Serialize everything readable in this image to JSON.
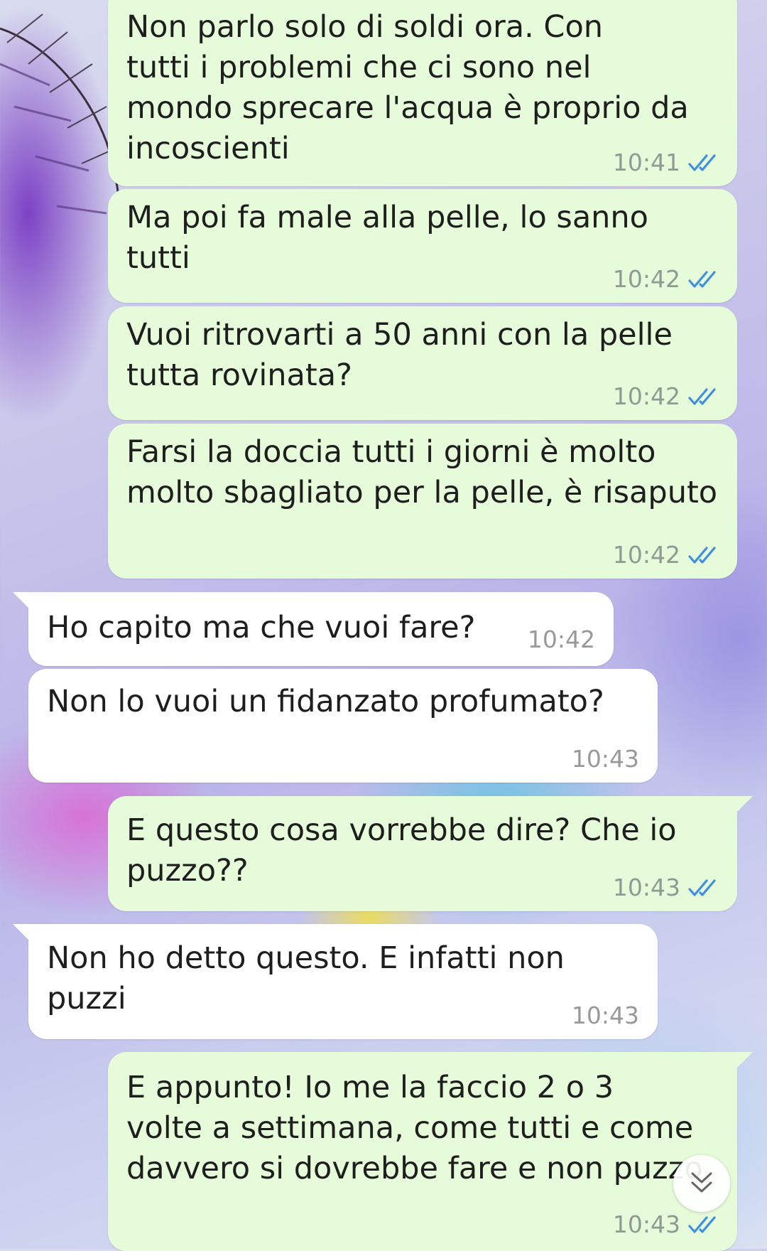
{
  "chat": {
    "messages": [
      {
        "direction": "outgoing",
        "text": "Non parlo solo di soldi ora. Con\ntutti i problemi che ci sono nel\nmondo sprecare l'acqua è proprio da\nincoscienti",
        "time": "10:41",
        "status": "read"
      },
      {
        "direction": "outgoing",
        "text": "Ma poi fa male alla pelle, lo sanno\ntutti",
        "time": "10:42",
        "status": "read"
      },
      {
        "direction": "outgoing",
        "text": "Vuoi ritrovarti a 50 anni con la pelle\ntutta rovinata?",
        "time": "10:42",
        "status": "read"
      },
      {
        "direction": "outgoing",
        "text": "Farsi la doccia tutti i giorni è molto\nmolto sbagliato per la pelle, è risaputo",
        "time": "10:42",
        "status": "read"
      },
      {
        "direction": "incoming",
        "text": "Ho capito ma che vuoi fare?",
        "time": "10:42"
      },
      {
        "direction": "incoming",
        "text": "Non lo vuoi un fidanzato profumato?",
        "time": "10:43"
      },
      {
        "direction": "outgoing",
        "text": "E questo cosa vorrebbe dire? Che io\npuzzo??",
        "time": "10:43",
        "status": "read"
      },
      {
        "direction": "incoming",
        "text": "Non ho detto questo. E infatti non\npuzzi",
        "time": "10:43"
      },
      {
        "direction": "outgoing",
        "text": "E appunto! Io me la faccio 2 o 3\nvolte a settimana, come tutti e come\ndavvero si dovrebbe fare e non puzzo",
        "time": "10:43",
        "status": "read"
      }
    ]
  },
  "icons": {
    "read_receipt": "double-check-icon",
    "scroll_down": "chevron-double-down-icon"
  },
  "colors": {
    "outgoing_bubble": "#e6fbd9",
    "incoming_bubble": "#ffffff",
    "read_ticks": "#3f8fe0",
    "timestamp": "#8f9a93"
  }
}
